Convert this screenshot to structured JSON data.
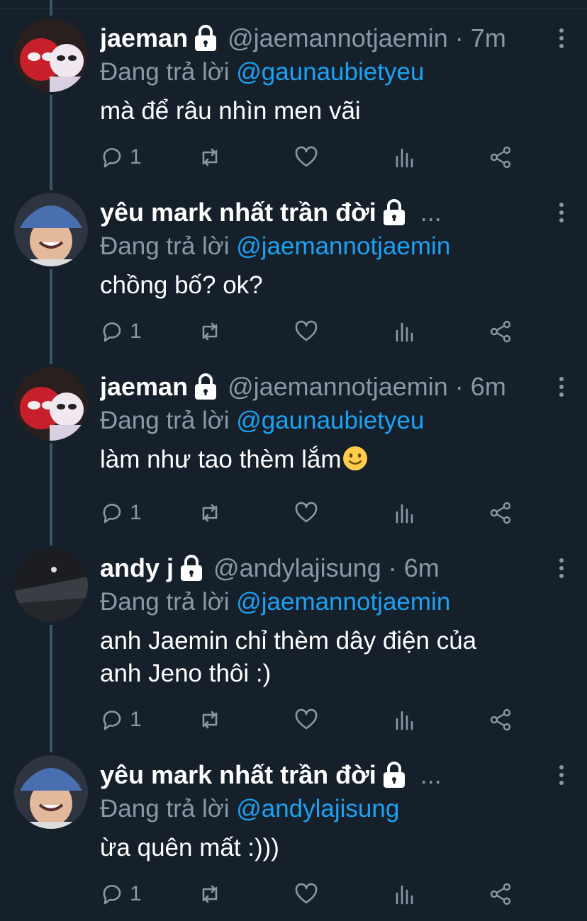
{
  "tweets": [
    {
      "name": "jaeman",
      "handle": "@jaemannotjaemin",
      "time": "7m",
      "reply_prefix": "Đang trả lời",
      "reply_to": "@gaunaubietyeu",
      "text": "mà để râu nhìn men vãi",
      "reply_count": "1",
      "avatar": "spiderman-avatar"
    },
    {
      "name": "yêu mark nhất trần đời",
      "handle": "",
      "time": "",
      "truncated": "...",
      "reply_prefix": "Đang trả lời",
      "reply_to": "@jaemannotjaemin",
      "text": "chồng bố? ok?",
      "reply_count": "1",
      "avatar": "bucket-hat-avatar"
    },
    {
      "name": "jaeman",
      "handle": "@jaemannotjaemin",
      "time": "6m",
      "reply_prefix": "Đang trả lời",
      "reply_to": "@gaunaubietyeu",
      "text": "làm như tao thèm lắm",
      "emoji": "slightly-smiling-face",
      "reply_count": "1",
      "avatar": "spiderman-avatar"
    },
    {
      "name": "andy j",
      "handle": "@andylajisung",
      "time": "6m",
      "reply_prefix": "Đang trả lời",
      "reply_to": "@jaemannotjaemin",
      "text_line1": "anh Jaemin chỉ thèm dây điện của",
      "text_line2": "anh Jeno thôi :)",
      "reply_count": "1",
      "avatar": "dark-room-avatar"
    },
    {
      "name": "yêu mark nhất trần đời",
      "handle": "",
      "time": "",
      "truncated": "...",
      "reply_prefix": "Đang trả lời",
      "reply_to": "@andylajisung",
      "text": "ừa quên mất :)))",
      "reply_count": "1",
      "avatar": "bucket-hat-avatar"
    }
  ],
  "icons": [
    "reply-icon",
    "retweet-icon",
    "like-icon",
    "stats-icon",
    "share-icon",
    "lock-icon",
    "more-icon"
  ],
  "colors": {
    "background": "#15202b",
    "muted": "#8899a6",
    "mention": "#1da1f2",
    "thread": "#3d5466"
  }
}
